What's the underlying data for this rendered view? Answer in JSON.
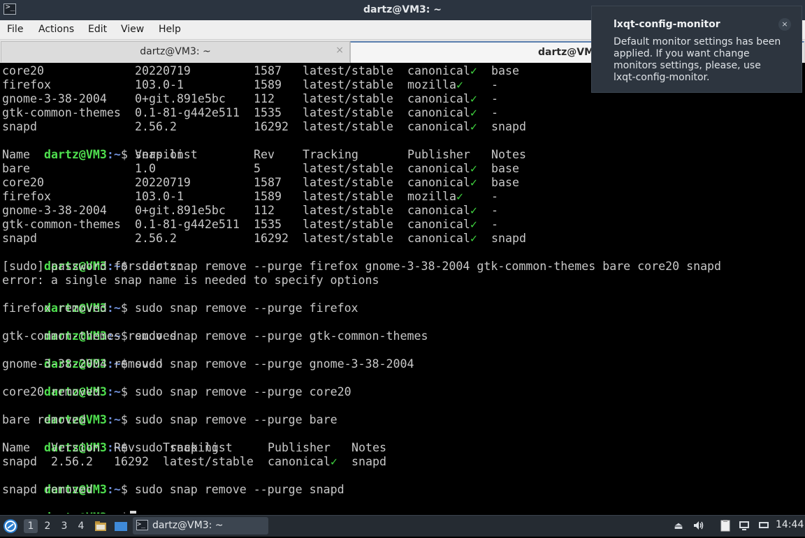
{
  "window": {
    "title": "dartz@VM3: ~",
    "app_icon_glyph": ">_"
  },
  "menubar": {
    "items": [
      "File",
      "Actions",
      "Edit",
      "View",
      "Help"
    ]
  },
  "tabs": [
    {
      "label": "dartz@VM3: ~",
      "active": false,
      "close_glyph": "×"
    },
    {
      "label": "dartz@VM3: ~",
      "active": true
    }
  ],
  "terminal": {
    "prompt_user": "dartz@VM3",
    "prompt_path": ":~",
    "prompt_symbol": "$",
    "snap_rows_top": [
      [
        "core20",
        "20220719",
        "1587",
        "latest/stable",
        "canonical",
        "base"
      ],
      [
        "firefox",
        "103.0-1",
        "1589",
        "latest/stable",
        "mozilla",
        "-"
      ],
      [
        "gnome-3-38-2004",
        "0+git.891e5bc",
        "112",
        "latest/stable",
        "canonical",
        "-"
      ],
      [
        "gtk-common-themes",
        "0.1-81-g442e511",
        "1535",
        "latest/stable",
        "canonical",
        "-"
      ],
      [
        "snapd",
        "2.56.2",
        "16292",
        "latest/stable",
        "canonical",
        "snapd"
      ]
    ],
    "cmd_snap_list": "snap list",
    "list_header": [
      "Name",
      "Version",
      "Rev",
      "Tracking",
      "Publisher",
      "Notes"
    ],
    "snap_rows_full": [
      [
        "bare",
        "1.0",
        "5",
        "latest/stable",
        "canonical",
        "base"
      ],
      [
        "core20",
        "20220719",
        "1587",
        "latest/stable",
        "canonical",
        "base"
      ],
      [
        "firefox",
        "103.0-1",
        "1589",
        "latest/stable",
        "mozilla",
        "-"
      ],
      [
        "gnome-3-38-2004",
        "0+git.891e5bc",
        "112",
        "latest/stable",
        "canonical",
        "-"
      ],
      [
        "gtk-common-themes",
        "0.1-81-g442e511",
        "1535",
        "latest/stable",
        "canonical",
        "-"
      ],
      [
        "snapd",
        "2.56.2",
        "16292",
        "latest/stable",
        "canonical",
        "snapd"
      ]
    ],
    "check_mark": "✓",
    "cmd_remove_all": "sudo snap remove --purge firefox gnome-3-38-2004 gtk-common-themes bare core20 snapd",
    "sudo_prompt": "[sudo] password for dartz:",
    "error_line": "error: a single snap name is needed to specify options",
    "cmd_rm_firefox": "sudo snap remove --purge firefox",
    "out_rm_firefox": "firefox removed",
    "cmd_rm_gtk": "sudo snap remove --purge gtk-common-themes",
    "out_rm_gtk": "gtk-common-themes removed",
    "cmd_rm_gnome": "sudo snap remove --purge gnome-3-38-2004",
    "out_rm_gnome": "gnome-3-38-2004 removed",
    "cmd_rm_core20": "sudo snap remove --purge core20",
    "out_rm_core20": "core20 removed",
    "cmd_rm_bare": "sudo snap remove --purge bare",
    "out_rm_bare": "bare removed",
    "cmd_sudo_list": "sudo snap list",
    "small_header": [
      "Name",
      "Version",
      "Rev",
      "Tracking",
      "Publisher",
      "Notes"
    ],
    "small_row": [
      "snapd",
      "2.56.2",
      "16292",
      "latest/stable",
      "canonical",
      "snapd"
    ],
    "cmd_rm_snapd": "sudo snap remove --purge snapd",
    "out_rm_snapd": "snapd removed"
  },
  "notification": {
    "title": "lxqt-config-monitor",
    "body": "Default monitor settings has been applied. If you want change monitors settings, please, use lxqt-config-monitor.",
    "close_glyph": "×"
  },
  "taskbar": {
    "desktops": [
      "1",
      "2",
      "3",
      "4"
    ],
    "active_desktop": "1",
    "task_label": "dartz@VM3: ~",
    "clock": "14:44"
  }
}
